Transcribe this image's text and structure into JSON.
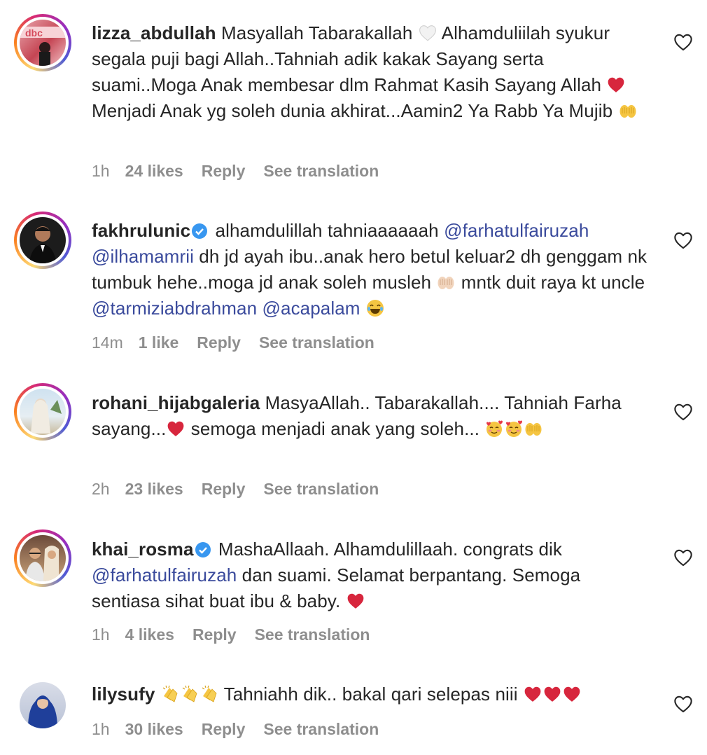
{
  "comments": [
    {
      "username": "lizza_abdullah",
      "text_parts": [
        " Masyallah Tabarakallah ",
        " Alhamduliilah syukur segala puji bagi Allah..Tahniah adik kakak Sayang serta suami..Moga Anak membesar dlm Rahmat Kasih Sayang Allah ",
        " Menjadi Anak yg soleh dunia akhirat...Aamin2 Ya Rabb Ya Mujib "
      ],
      "time": "1h",
      "likes": "24 likes",
      "reply": "Reply",
      "translate": "See translation"
    },
    {
      "username": "fakhrulunic",
      "text_parts": [
        " alhamdulillah tahniaaaaaah ",
        "@farhatulfairuzah",
        " ",
        "@ilhamamrii",
        " dh jd ayah ibu..anak hero betul keluar2 dh genggam nk tumbuk hehe..moga jd anak soleh musleh ",
        " mntk duit raya kt uncle ",
        "@tarmiziabdrahman",
        " ",
        "@acapalam",
        " "
      ],
      "time": "14m",
      "likes": "1 like",
      "reply": "Reply",
      "translate": "See translation"
    },
    {
      "username": "rohani_hijabgaleria",
      "text_parts": [
        " MasyaAllah.. Tabarakallah.... Tahniah Farha sayang...",
        " semoga menjadi anak yang soleh... "
      ],
      "time": "2h",
      "likes": "23 likes",
      "reply": "Reply",
      "translate": "See translation"
    },
    {
      "username": "khai_rosma",
      "text_parts": [
        " MashaAllaah. Alhamdulillaah. congrats dik ",
        "@farhatulfairuzah",
        " dan suami. Selamat berpantang. Semoga sentiasa sihat buat ibu & baby. "
      ],
      "time": "1h",
      "likes": "4 likes",
      "reply": "Reply",
      "translate": "See translation"
    },
    {
      "username": "lilysufy",
      "text_parts": [
        " ",
        " Tahniahh dik.. bakal qari selepas niii "
      ],
      "time": "1h",
      "likes": "30 likes",
      "reply": "Reply",
      "translate": "See translation"
    }
  ],
  "colors": {
    "text": "#262626",
    "meta": "#8e8e8e",
    "mention": "#3a4a9c",
    "verified": "#3897f0",
    "heart_red": "#d7263d"
  },
  "icons": [
    "heart-outline-icon",
    "verified-badge-icon",
    "red-heart-emoji",
    "white-heart-emoji",
    "praying-hands-emoji",
    "clapping-hands-emoji",
    "laughing-emoji",
    "blushing-hearts-emoji"
  ]
}
